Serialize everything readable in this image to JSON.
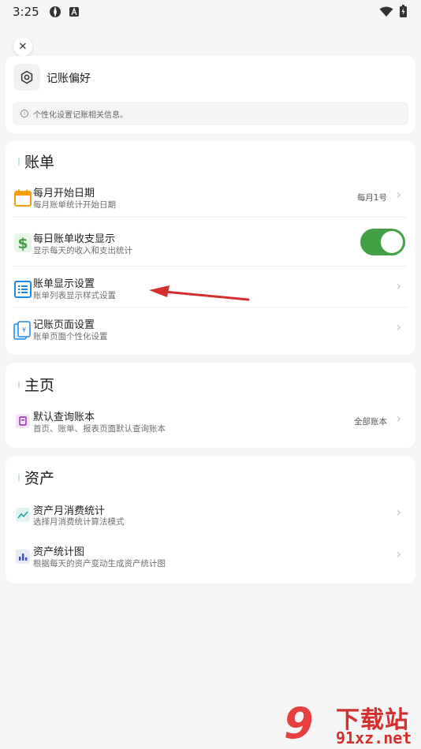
{
  "status_bar": {
    "time": "3:25"
  },
  "preferences": {
    "title": "记账偏好",
    "info": "个性化设置记账相关信息。"
  },
  "bill_section": {
    "title": "账单",
    "items": [
      {
        "title": "每月开始日期",
        "subtitle": "每月账单统计开始日期",
        "value": "每月1号"
      },
      {
        "title": "每日账单收支显示",
        "subtitle": "显示每天的收入和支出统计",
        "toggle": true
      },
      {
        "title": "账单显示设置",
        "subtitle": "账单列表显示样式设置"
      },
      {
        "title": "记账页面设置",
        "subtitle": "账单页面个性化设置"
      }
    ]
  },
  "home_section": {
    "title": "主页",
    "items": [
      {
        "title": "默认查询账本",
        "subtitle": "首页、账单、报表页面默认查询账本",
        "value": "全部账本"
      }
    ]
  },
  "asset_section": {
    "title": "资产",
    "items": [
      {
        "title": "资产月消费统计",
        "subtitle": "选择月消费统计算法模式"
      },
      {
        "title": "资产统计图",
        "subtitle": "根据每天的资产变动生成资产统计图"
      }
    ]
  },
  "watermark": {
    "brand": "下载站",
    "url": "91xz.net",
    "logo": "9"
  },
  "colors": {
    "accent_green": "#43a047",
    "arrow_red": "#d32f2f",
    "calendar_orange": "#f59e0b",
    "list_blue": "#1e88e5"
  }
}
